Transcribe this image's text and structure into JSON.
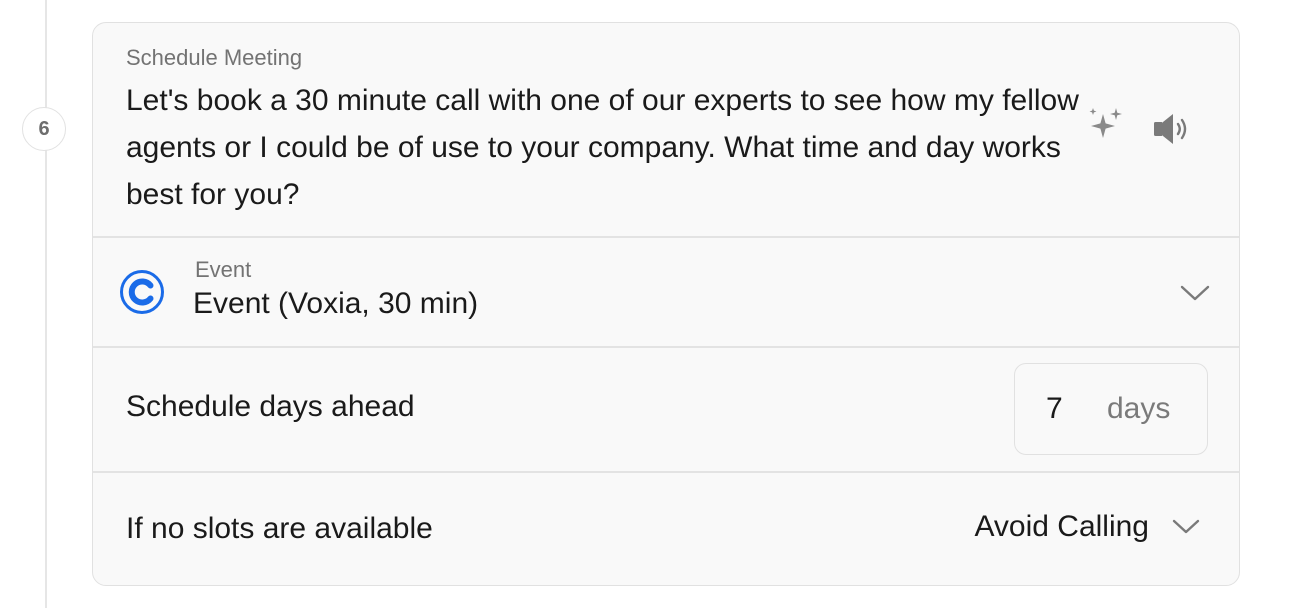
{
  "step": {
    "number": "6"
  },
  "message": {
    "caption": "Schedule Meeting",
    "text": "Let's book a 30 minute call with one of our experts to see how my fellow agents or I could be of use to your company. What time and day works best for you?",
    "icons": [
      "sparkles-icon",
      "speaker-icon"
    ]
  },
  "event": {
    "caption": "Event",
    "value": "Event (Voxia, 30 min)",
    "logo": "calendly-logo",
    "dropdown_icon": "chevron-down-icon"
  },
  "schedule_days": {
    "label": "Schedule days ahead",
    "value": "7",
    "unit": "days"
  },
  "no_slots": {
    "label": "If no slots are available",
    "value": "Avoid Calling",
    "dropdown_icon": "chevron-down-icon"
  },
  "colors": {
    "card_background": "#f9f9f9",
    "border": "#e1e1e1",
    "muted_text": "#737373",
    "text": "#1a1a1a",
    "calendly_blue": "#1a6be8"
  }
}
